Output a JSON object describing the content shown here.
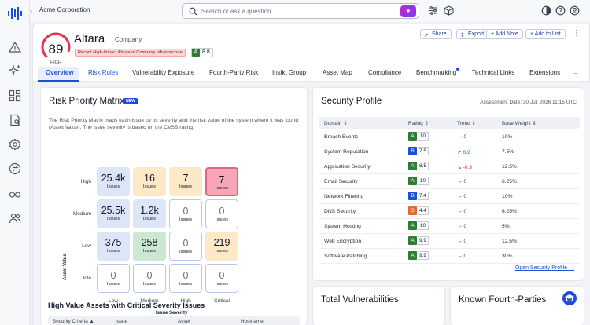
{
  "colors": {
    "accent": "#1d4ed8",
    "grade_a": "#2e7d32",
    "grade_b": "#1d4ed8",
    "grade_d": "#e46b2f",
    "alert_bg": "#fbd5d5"
  },
  "topbar": {
    "org_name": "Acme Corporation",
    "search_placeholder": "Search or ask a question"
  },
  "sidebar": {
    "icons": [
      "logo-icon",
      "alert-icon",
      "sparkle-icon",
      "dashboard-icon",
      "report-icon",
      "settings-icon",
      "swap-icon",
      "glasses-icon",
      "users-icon"
    ]
  },
  "company": {
    "score": "89",
    "score_label": "HIGH",
    "score_value": 89,
    "name": "Altara",
    "type": "Company",
    "alert": "Recent High-Impact Abuse of Company Infrastructure",
    "grade": "A",
    "grade_value": "8.8"
  },
  "actions": {
    "share": "Share",
    "export": "Export",
    "add_note": "+ Add Note",
    "add_to_list": "+ Add to List"
  },
  "tabs": [
    "Overview",
    "Risk Rules",
    "Vulnerability Exposure",
    "Fourth-Party Risk",
    "Insikt Group",
    "Asset Map",
    "Compliance",
    "Benchmarking",
    "Technical Links",
    "Extensions"
  ],
  "rpm": {
    "title": "Risk Priority Matrix",
    "badge": "NEW",
    "description": "The Risk Priority Matrix maps each issue by its severity and the risk value of the system where it was found (Asset Value). The issue severity is based on the CVSS rating.",
    "row_labels": [
      "High",
      "Medium",
      "Low",
      "Idle"
    ],
    "col_labels": [
      "Low",
      "Medium",
      "High",
      "Critical"
    ],
    "unit": "Issues",
    "x_axis": "Issue Severity",
    "y_axis": "Asset Value",
    "cells": [
      [
        {
          "v": "25.4k"
        },
        {
          "v": "16"
        },
        {
          "v": "7"
        },
        {
          "v": "7"
        }
      ],
      [
        {
          "v": "25.5k"
        },
        {
          "v": "1.2k"
        },
        {
          "v": "0"
        },
        {
          "v": "0"
        }
      ],
      [
        {
          "v": "375"
        },
        {
          "v": "258"
        },
        {
          "v": "0"
        },
        {
          "v": "219"
        }
      ],
      [
        {
          "v": "0"
        },
        {
          "v": "0"
        },
        {
          "v": "0"
        },
        {
          "v": "0"
        }
      ]
    ]
  },
  "hva": {
    "title": "High Value Assets with Critical Severity Issues",
    "columns": [
      "Security Criteria",
      "Issue",
      "Asset",
      "Hostname"
    ]
  },
  "security_profile": {
    "title": "Security Profile",
    "assessment_date": "Assessment Date: 30 Jul, 2026 11:15 UTC",
    "columns": [
      "Domain",
      "Rating",
      "Trend",
      "Base Weight"
    ],
    "rows": [
      {
        "domain": "Breach Events",
        "grade": "A",
        "value": "10",
        "trend": "0",
        "weight": "10%"
      },
      {
        "domain": "System Reputation",
        "grade": "B",
        "value": "7.5",
        "trend": "0.2",
        "weight": "7.5%"
      },
      {
        "domain": "Application Security",
        "grade": "A",
        "value": "8.5",
        "trend": "-0.3",
        "weight": "12.5%"
      },
      {
        "domain": "Email Security",
        "grade": "A",
        "value": "10",
        "trend": "0",
        "weight": "6.25%"
      },
      {
        "domain": "Network Filtering",
        "grade": "B",
        "value": "7.4",
        "trend": "0",
        "weight": "10%"
      },
      {
        "domain": "DNS Security",
        "grade": "D",
        "value": "4.4",
        "trend": "0",
        "weight": "6.25%"
      },
      {
        "domain": "System Hosting",
        "grade": "A",
        "value": "10",
        "trend": "0",
        "weight": "5%"
      },
      {
        "domain": "Web Encryption",
        "grade": "A",
        "value": "9.9",
        "trend": "0",
        "weight": "12.5%"
      },
      {
        "domain": "Software Patching",
        "grade": "A",
        "value": "9.9",
        "trend": "0",
        "weight": "30%"
      }
    ],
    "link": "Open Security Profile"
  },
  "total_vulnerabilities": {
    "title": "Total Vulnerabilities"
  },
  "fourth_parties": {
    "title": "Known Fourth-Parties"
  }
}
